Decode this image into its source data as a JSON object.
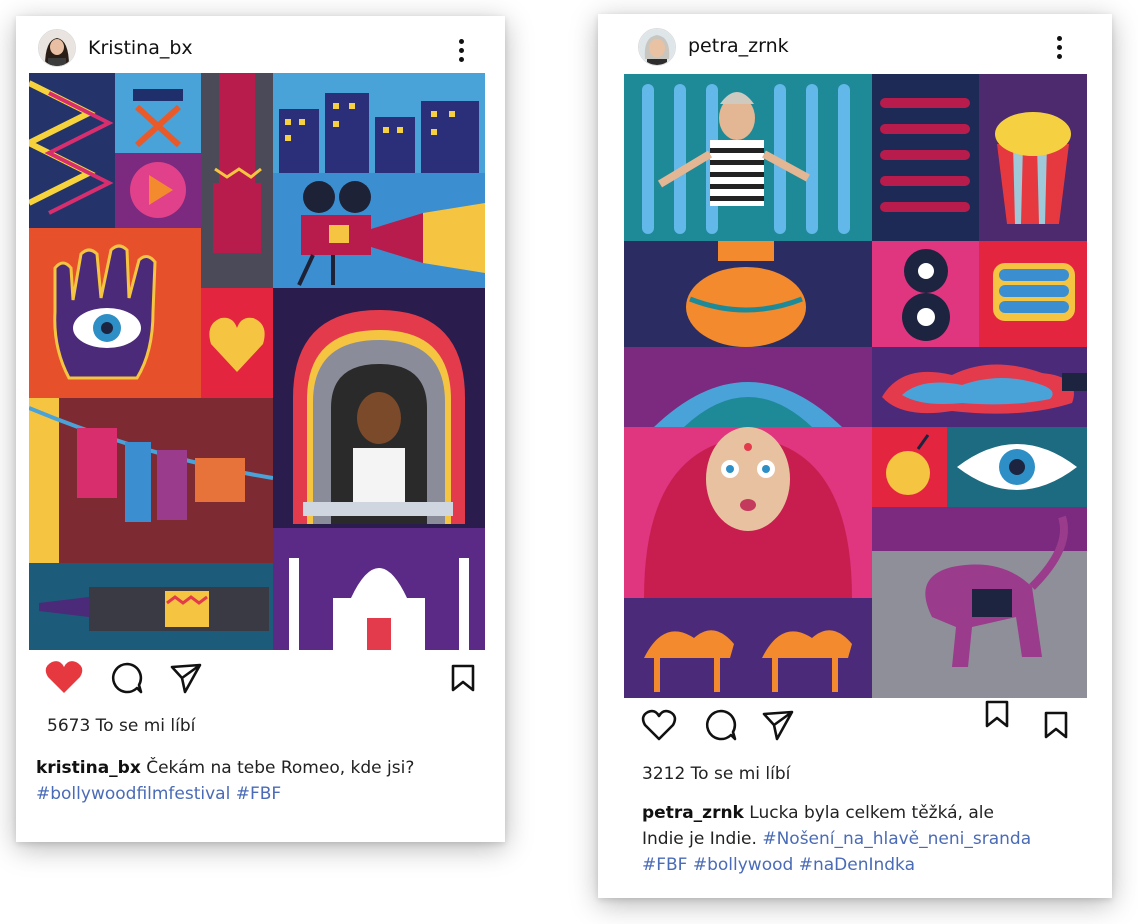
{
  "posts": [
    {
      "username": "Kristina_bx",
      "likes_text": "5673 To se mi líbí",
      "caption_user": "kristina_bx",
      "caption_text": " Čekám na tebe Romeo, kde jsi?",
      "hashtags_line": "#bollywoodfilmfestival #FBF",
      "liked": true
    },
    {
      "username": "petra_zrnk",
      "likes_text": "3212 To se mi líbí",
      "caption_user": "petra_zrnk",
      "caption_text": " Lucka byla celkem těžká, ale",
      "caption_text2": "Indie je Indie. ",
      "hashtag_inline": "#Nošení_na_hlavě_neni_sranda",
      "hashtags_line": "#FBF #bollywood #naDenIndka",
      "liked": false
    }
  ],
  "colors": {
    "like_red": "#e5393f",
    "hashtag_blue": "#4a6bb7"
  },
  "icons": [
    "heart-icon",
    "comment-icon",
    "share-icon",
    "bookmark-icon",
    "more-icon"
  ]
}
